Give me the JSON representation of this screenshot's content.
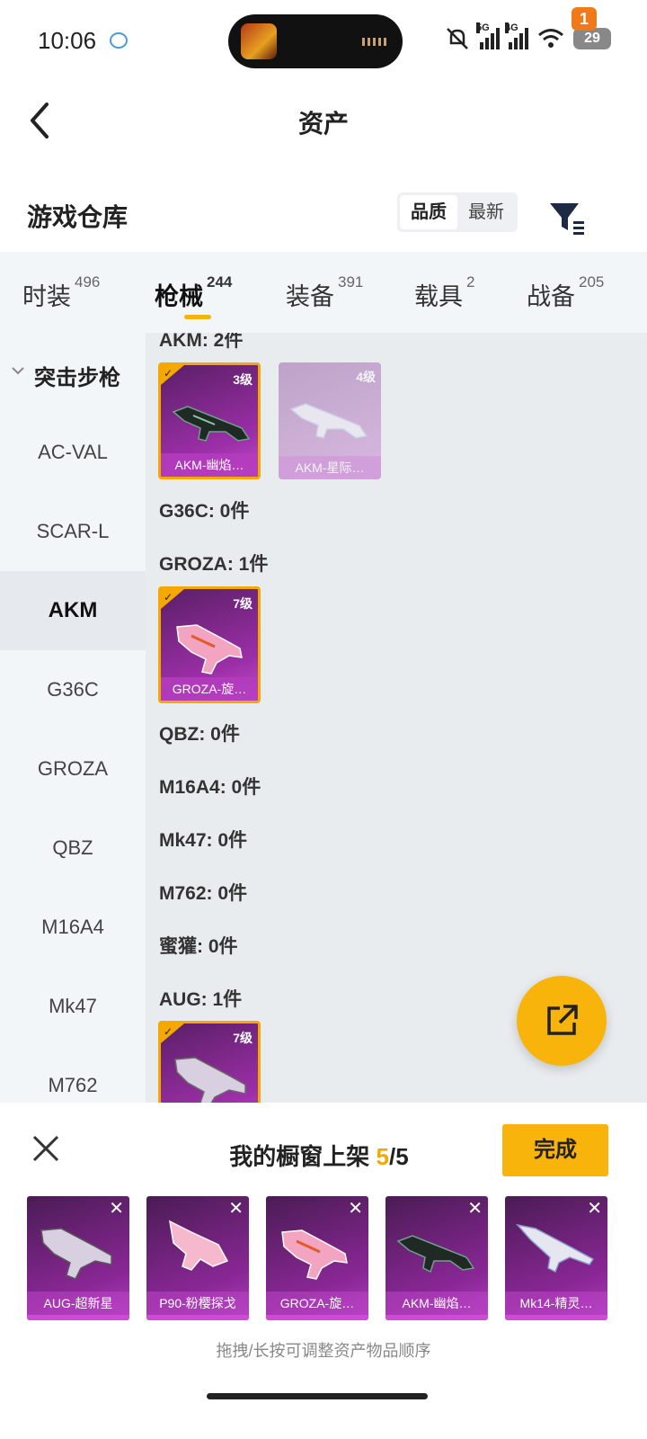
{
  "status": {
    "time": "10:06",
    "battery": "29",
    "net1": "5G",
    "net2": "4G"
  },
  "nav": {
    "title": "资产"
  },
  "warehouse": {
    "title": "游戏仓库",
    "sort_quality": "品质",
    "sort_latest": "最新",
    "filter_badge": "1"
  },
  "tabs": [
    {
      "label": "时装",
      "count": "496"
    },
    {
      "label": "枪械",
      "count": "244"
    },
    {
      "label": "装备",
      "count": "391"
    },
    {
      "label": "载具",
      "count": "2"
    },
    {
      "label": "战备",
      "count": "205"
    }
  ],
  "sidebar": {
    "group": "突击步枪",
    "items": [
      "AC-VAL",
      "SCAR-L",
      "AKM",
      "G36C",
      "GROZA",
      "QBZ",
      "M16A4",
      "Mk47",
      "M762"
    ]
  },
  "main": {
    "sections": [
      "AKM: 2件",
      "G36C: 0件",
      "GROZA: 1件",
      "QBZ: 0件",
      "M16A4: 0件",
      "Mk47: 0件",
      "M762: 0件",
      "蜜獾: 0件",
      "AUG: 1件"
    ],
    "cards": [
      {
        "name": "AKM-幽焰…",
        "level": "3级"
      },
      {
        "name": "AKM-星际…",
        "level": "4级"
      },
      {
        "name": "GROZA-旋…",
        "level": "7级"
      },
      {
        "name": "",
        "level": "7级"
      }
    ]
  },
  "sheet": {
    "title": "我的橱窗上架",
    "current": "5",
    "total": "/5",
    "done": "完成",
    "items": [
      "AUG-超新星",
      "P90-粉樱探戈",
      "GROZA-旋…",
      "AKM-幽焰…",
      "Mk14-精灵…"
    ],
    "hint": "拖拽/长按可调整资产物品顺序"
  },
  "colors": {
    "accent": "#f8b40a",
    "card_purple": "#9c2fa8",
    "badge": "#f07a1a"
  }
}
